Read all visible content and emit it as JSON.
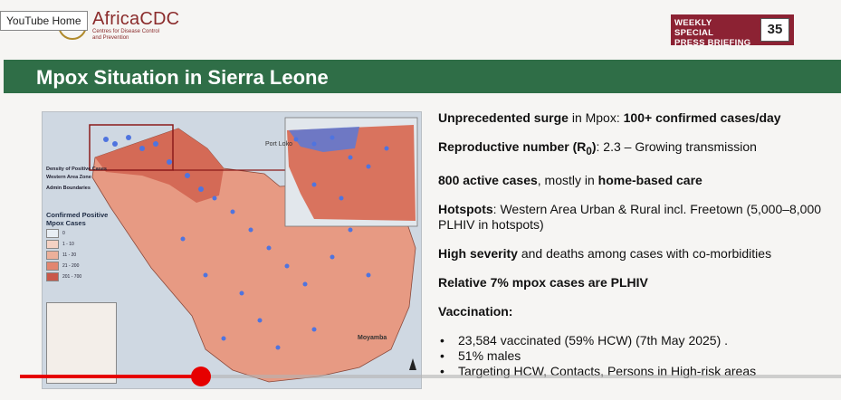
{
  "overlay": {
    "youtube_home": "YouTube Home"
  },
  "header": {
    "org_name": "AfricaCDC",
    "org_subtitle_1": "Centres for Disease Control",
    "org_subtitle_2": "and Prevention",
    "briefing_line1": "WEEKLY SPECIAL",
    "briefing_line2": "PRESS BRIEFING",
    "briefing_number": "35"
  },
  "slide": {
    "title": "Mpox Situation in Sierra Leone"
  },
  "map": {
    "legend_density_title": "Density of Positive Cases",
    "legend_zone_title": "Western Area Zone",
    "legend_admin": "Admin Boundaries",
    "legend_confirmed_title": "Confirmed Positive Mpox Cases",
    "classes": [
      {
        "label": "0",
        "color": "#e8eef4"
      },
      {
        "label": "1 - 10",
        "color": "#f5d2c4"
      },
      {
        "label": "11 - 20",
        "color": "#ecb09a"
      },
      {
        "label": "21 - 200",
        "color": "#e28670"
      },
      {
        "label": "201 - 700",
        "color": "#c9584a"
      }
    ],
    "place_port_loko": "Port Loko",
    "place_moyamba": "Moyamba"
  },
  "bullets": [
    {
      "bold": "Unprecedented surge",
      "rest": " in Mpox: ",
      "bold2": "100+ confirmed cases/day"
    },
    {
      "bold": "Reproductive number (R",
      "sub": "0",
      "bold_end": ")",
      "rest": ": 2.3 – Growing transmission"
    },
    {
      "bold": "800 active cases",
      "rest": ", mostly in ",
      "bold2": "home-based care"
    },
    {
      "bold": "Hotspots",
      "rest": ": Western Area Urban & Rural incl. Freetown (5,000–8,000 PLHIV in hotspots)"
    },
    {
      "bold": "High severity",
      "rest": " and deaths among cases with co-morbidities"
    },
    {
      "bold": "Relative 7% mpox cases are PLHIV",
      "rest": ""
    }
  ],
  "vaccination": {
    "heading": "Vaccination:",
    "items": [
      "23,584 vaccinated (59% HCW) (7th May 2025) .",
      "51% males",
      "Targeting HCW, Contacts, Persons in High-risk areas"
    ]
  },
  "player": {
    "progress_fraction": 0.22
  }
}
